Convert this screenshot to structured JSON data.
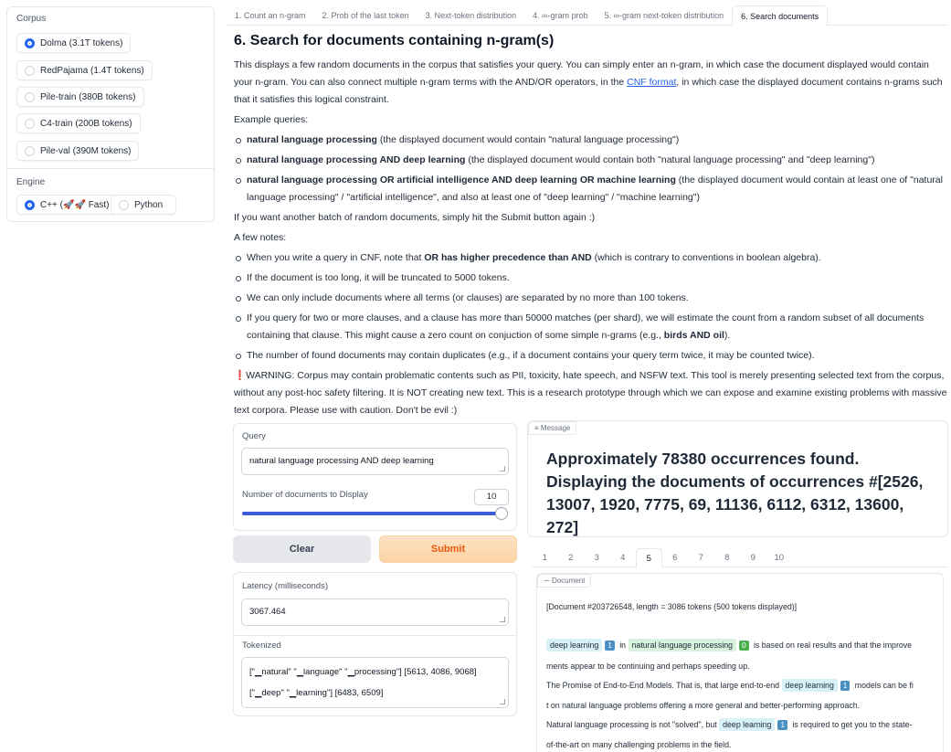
{
  "sidebar": {
    "corpus_label": "Corpus",
    "corpus_options": [
      {
        "label": "Dolma (3.1T tokens)",
        "selected": true
      },
      {
        "label": "RedPajama (1.4T tokens)",
        "selected": false
      },
      {
        "label": "Pile-train (380B tokens)",
        "selected": false
      },
      {
        "label": "C4-train (200B tokens)",
        "selected": false
      },
      {
        "label": "Pile-val (390M tokens)",
        "selected": false
      }
    ],
    "engine_label": "Engine",
    "engine_options": [
      {
        "label": "C++ (🚀🚀 Fast)",
        "selected": true
      },
      {
        "label": "Python",
        "selected": false
      }
    ]
  },
  "tabs": [
    {
      "label": "1. Count an n-gram"
    },
    {
      "label": "2. Prob of the last token"
    },
    {
      "label": "3. Next-token distribution"
    },
    {
      "label": "4. ∞-gram prob"
    },
    {
      "label": "5. ∞-gram next-token distribution"
    },
    {
      "label": "6. Search documents",
      "active": true
    }
  ],
  "content": {
    "title": "6. Search for documents containing n-gram(s)",
    "intro_1": "This displays a few random documents in the corpus that satisfies your query. You can simply enter an n-gram, in which case the document displayed would contain your n-gram. You can also connect multiple n-gram terms with the AND/OR operators, in the ",
    "intro_link": "CNF format",
    "intro_2": ", in which case the displayed document contains n-grams such that it satisfies this logical constraint.",
    "examples_label": "Example queries:",
    "examples": [
      {
        "bold": "natural language processing",
        "rest": " (the displayed document would contain \"natural language processing\")"
      },
      {
        "bold": "natural language processing AND deep learning",
        "rest": " (the displayed document would contain both \"natural language processing\" and \"deep learning\")"
      },
      {
        "bold": "natural language processing OR artificial intelligence AND deep learning OR machine learning",
        "rest": " (the displayed document would contain at least one of \"natural language processing\" / \"artificial intelligence\", and also at least one of \"deep learning\" / \"machine learning\")"
      }
    ],
    "resubmit_note": "If you want another batch of random documents, simply hit the Submit button again :)",
    "notes_label": "A few notes:",
    "note_1_a": "When you write a query in CNF, note that ",
    "note_1_bold": "OR has higher precedence than AND",
    "note_1_b": " (which is contrary to conventions in boolean algebra).",
    "note_2": "If the document is too long, it will be truncated to 5000 tokens.",
    "note_3": "We can only include documents where all terms (or clauses) are separated by no more than 100 tokens.",
    "note_4_a": "If you query for two or more clauses, and a clause has more than 50000 matches (per shard), we will estimate the count from a random subset of all documents containing that clause. This might cause a zero count on conjuction of some simple n-grams (e.g., ",
    "note_4_bold": "birds AND oil",
    "note_4_b": ").",
    "note_5": "The number of found documents may contain duplicates (e.g., if a document contains your query term twice, it may be counted twice).",
    "warning_icon": "❗",
    "warning": "WARNING: Corpus may contain problematic contents such as PII, toxicity, hate speech, and NSFW text. This tool is merely presenting selected text from the corpus, without any post-hoc safety filtering. It is NOT creating new text. This is a research prototype through which we can expose and examine existing problems with massive text corpora. Please use with caution. Don't be evil :)"
  },
  "query_panel": {
    "query_label": "Query",
    "query_value": "natural language processing AND deep learning",
    "num_docs_label": "Number of documents to Display",
    "num_docs_value": "10",
    "slider_fraction": 1.0
  },
  "buttons": {
    "clear": "Clear",
    "submit": "Submit"
  },
  "latency_panel": {
    "latency_label": "Latency (milliseconds)",
    "latency_value": "3067.464",
    "tokenized_label": "Tokenized",
    "tokenized_line_1": "[\"▁natural\" \"▁language\" \"▁processing\"] [5613, 4086, 9068]",
    "tokenized_line_2": "[\"▁deep\" \"▁learning\"] [6483, 6509]"
  },
  "message_panel": {
    "badge": "Message",
    "text": "Approximately 78380 occurrences found. Displaying the documents of occurrences #[2526, 13007, 1920, 7775, 69, 11136, 6112, 6312, 13600, 272]"
  },
  "doc_tabs": [
    "1",
    "2",
    "3",
    "4",
    "5",
    "6",
    "7",
    "8",
    "9",
    "10"
  ],
  "doc_tabs_active": "5",
  "document": {
    "badge": "Document",
    "header": "[Document #203726548, length = 3086 tokens (500 tokens displayed)]",
    "l1_hl1": "deep learning",
    "l1_c1": "1",
    "l1_t1": " in ",
    "l1_hl2": "natural language processing",
    "l1_c2": "0",
    "l1_t2": " is based on real results and that the improve",
    "l2": "ments appear to be continuing and perhaps speeding up.",
    "l3_t1": "The Promise of End-to-End Models. That is, that large end-to-end ",
    "l3_hl": "deep learning",
    "l3_c": "1",
    "l3_t2": " models can be fi",
    "l4": "t on natural language problems offering a more general and better-performing approach.",
    "l5_t1": "Natural language processing is not \"solved\", but ",
    "l5_hl": "deep learning",
    "l5_c": "1",
    "l5_t2": " is required to get you to the state-",
    "l6": "of-the-art on many challenging problems in the field."
  },
  "icons": {
    "message_icon": "bar-chart-icon",
    "document_icon": "chart-icon"
  },
  "colors": {
    "accent": "#2563eb",
    "submit_text": "#ea580c",
    "submit_bg": "#fbd3a6",
    "highlight_blue": "#d7f1f7",
    "highlight_green": "#d9f2dd"
  }
}
